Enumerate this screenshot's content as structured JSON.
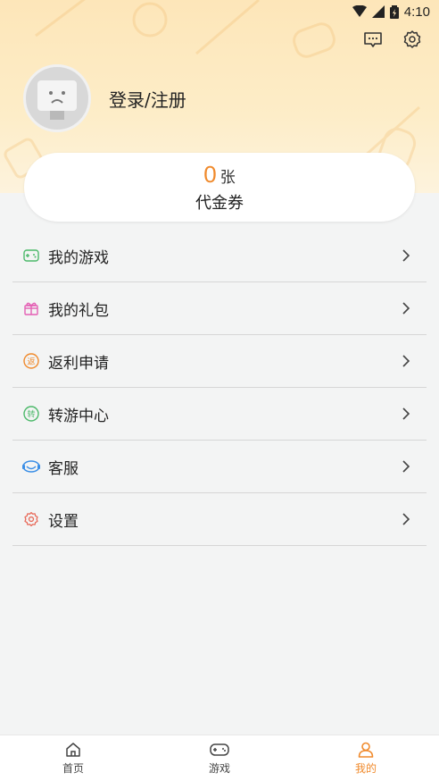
{
  "status_bar": {
    "time": "4:10"
  },
  "profile": {
    "login_label": "登录/注册"
  },
  "coupon": {
    "count": "0",
    "unit": "张",
    "label": "代金券"
  },
  "menu": {
    "items": [
      {
        "label": "我的游戏",
        "icon": "gamepad-icon",
        "color": "#4cb96a"
      },
      {
        "label": "我的礼包",
        "icon": "gift-icon",
        "color": "#e45fb4"
      },
      {
        "label": "返利申请",
        "icon": "rebate-icon",
        "color": "#f08a2c"
      },
      {
        "label": "转游中心",
        "icon": "transfer-icon",
        "color": "#4cb96a"
      },
      {
        "label": "客服",
        "icon": "customer-service-icon",
        "color": "#3a8ee6"
      },
      {
        "label": "设置",
        "icon": "settings-icon",
        "color": "#e86a5a"
      }
    ]
  },
  "bottom_nav": {
    "items": [
      {
        "label": "首页",
        "icon": "home-icon"
      },
      {
        "label": "游戏",
        "icon": "gamepad-icon"
      },
      {
        "label": "我的",
        "icon": "user-icon",
        "active": true
      }
    ]
  },
  "colors": {
    "accent": "#f08a2c",
    "header_bg": "#fde6b9"
  }
}
